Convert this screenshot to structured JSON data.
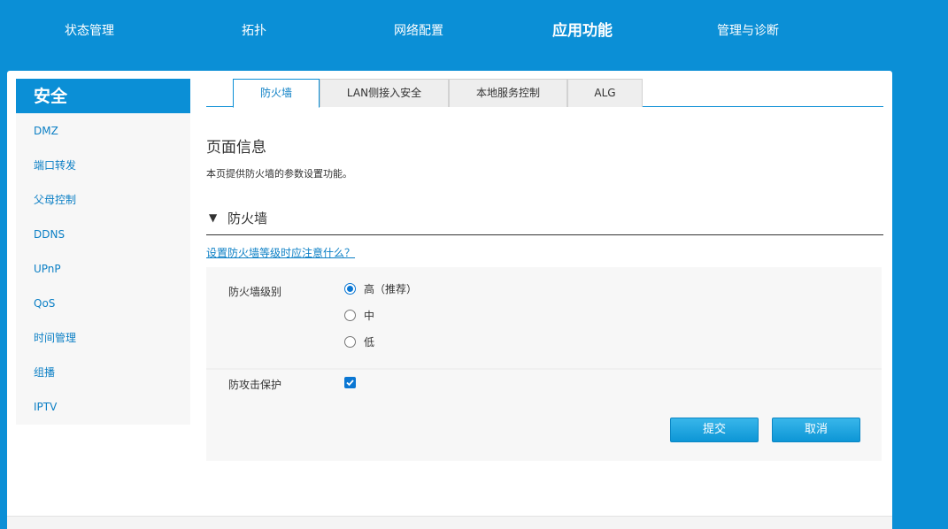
{
  "topnav": {
    "items": [
      {
        "label": "状态管理"
      },
      {
        "label": "拓扑"
      },
      {
        "label": "网络配置"
      },
      {
        "label": "应用功能"
      },
      {
        "label": "管理与诊断"
      }
    ],
    "active_index": 3
  },
  "sidebar": {
    "header": "安全",
    "items": [
      {
        "label": "DMZ"
      },
      {
        "label": "端口转发"
      },
      {
        "label": "父母控制"
      },
      {
        "label": "DDNS"
      },
      {
        "label": "UPnP"
      },
      {
        "label": "QoS"
      },
      {
        "label": "时间管理"
      },
      {
        "label": "组播"
      },
      {
        "label": "IPTV"
      }
    ]
  },
  "tabs": [
    {
      "label": "防火墙"
    },
    {
      "label": "LAN侧接入安全"
    },
    {
      "label": "本地服务控制"
    },
    {
      "label": "ALG"
    }
  ],
  "page": {
    "title": "页面信息",
    "description": "本页提供防火墙的参数设置功能。"
  },
  "section": {
    "arrow": "▼",
    "title": "防火墙",
    "help_link": "设置防火墙等级时应注意什么？"
  },
  "form": {
    "level_label": "防火墙级别",
    "levels": [
      {
        "label": "高（推荐）",
        "checked": true
      },
      {
        "label": "中",
        "checked": false
      },
      {
        "label": "低",
        "checked": false
      }
    ],
    "attack_protection_label": "防攻击保护",
    "attack_protection_checked": true
  },
  "buttons": {
    "submit": "提交",
    "cancel": "取消"
  },
  "colors": {
    "brand_blue": "#0b8fd6",
    "link_blue": "#0b7fc5",
    "control_blue": "#0b77d3"
  }
}
